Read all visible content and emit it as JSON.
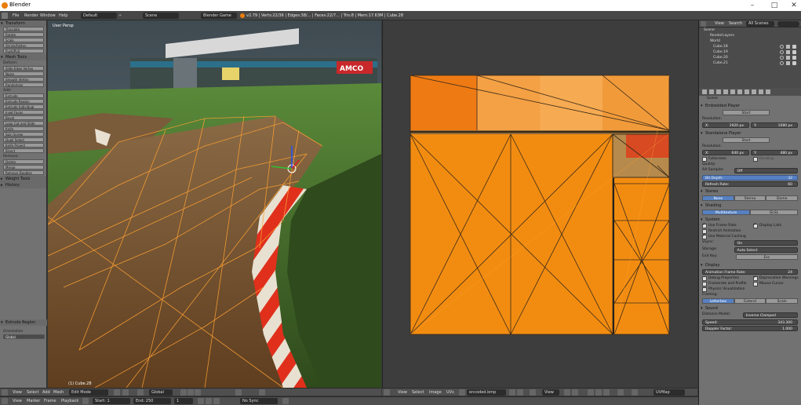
{
  "window": {
    "title": "Blender",
    "minimize": "–",
    "maximize": "□",
    "close": "✕"
  },
  "infobar": {
    "menus": [
      "File",
      "Render",
      "Window",
      "Help"
    ],
    "screen": "Default",
    "scene": "Scene",
    "engine": "Blender Game",
    "stats": "v2.79 | Verts:22/36 | Edges:38/... | Faces:22/7... | Tris:8 | Mem:17.63M | Cube.28"
  },
  "toolshelf": {
    "transform_panel": "Transform",
    "transform_buttons": [
      "Translate",
      "Rotate",
      "Scale",
      "Shrink/Fatten",
      "Push/Pull"
    ],
    "mesh_tools_panel": "Mesh Tools",
    "deform_label": "Deform:",
    "deform_buttons": [
      "Slide Edge  Vertex",
      "Noise",
      "Smooth Vertex",
      "Randomize"
    ],
    "add_label": "Add:",
    "add_buttons": [
      "Extrude",
      "Extrude Region",
      "Extrude Individual",
      "Inset Faces",
      "Bevel",
      "Loop Cut and Slide",
      "Knife",
      "Spin    Screw",
      "Dupli    Select",
      "Knife Project",
      "Bisect"
    ],
    "remove_label": "Remove:",
    "remove_buttons": [
      "Delete",
      "Merge",
      "Remove Doubles"
    ],
    "weight_panel": "Weight Tools",
    "history_panel": "History",
    "operator_panel": "Extrude Region",
    "orientation_label": "Orientation",
    "orientation_value": "Global"
  },
  "viewport": {
    "label": "User Persp",
    "object": "(1) Cube.28",
    "header": [
      "View",
      "Select",
      "Add",
      "Mesh"
    ],
    "mode": "Edit Mode",
    "pivot": "Global"
  },
  "uv_editor": {
    "header": [
      "View",
      "Select",
      "Image",
      "UVs"
    ],
    "image_name": "encoded.bmp",
    "view_label": "View",
    "uvmap": "UVMap"
  },
  "timeline": {
    "menus": [
      "View",
      "Marker",
      "Frame",
      "Playback"
    ],
    "start": "Start: 1",
    "end": "End: 250",
    "frame": "1",
    "sync": "No Sync"
  },
  "outliner": {
    "header": [
      "View",
      "Search",
      "All Scenes"
    ],
    "rows": [
      "Scene",
      "RenderLayers",
      "World",
      "Cube.18",
      "Cube.19",
      "Cube.20",
      "Cube.21"
    ]
  },
  "properties": {
    "scene_label": "Scene",
    "embedded_panel": "Embedded Player",
    "start_btn": "Start",
    "resolution_label": "Resolution:",
    "res_x_label": "X:",
    "res_x": "1920 px",
    "res_y_label": "Y:",
    "res_y": "1080 px",
    "standalone_panel": "Standalone Player",
    "start_btn2": "Start",
    "resolution_label2": "Resolution:",
    "res2_x_label": "X:",
    "res2_x": "640 px",
    "res2_y_label": "Y:",
    "res2_y": "480 px",
    "fullscreen": "Fullscreen",
    "desktop": "Desktop",
    "quality_label": "Quality:",
    "aa_label": "AA Samples",
    "aa_value": "Off",
    "bit_depth_label": "Bit Depth:",
    "bit_depth": "32",
    "refresh_label": "Refresh Rate:",
    "refresh": "60",
    "stereo_panel": "Stereo",
    "stereo_opts": [
      "None",
      "Stereo",
      "Dome"
    ],
    "shading_panel": "Shading",
    "shading_opts": [
      "Multitexture",
      "GLSL"
    ],
    "system_panel": "System",
    "use_frame_rate": "Use Frame Rate",
    "display_lists": "Display Lists",
    "restrict_anim": "Restrict Animation",
    "use_material": "Use Material Caching",
    "vsync_label": "Vsync:",
    "vsync_value": "On",
    "storage_label": "Storage:",
    "storage_value": "Auto Select",
    "exit_key_label": "Exit Key:",
    "exit_key": "Esc",
    "display_panel": "Display",
    "anim_frame_label": "Animation Frame Rate:",
    "anim_frame": "24",
    "debug_props": "Debug Properties",
    "deprecation": "Deprecation Warnings",
    "framerate_profile": "Framerate and Profile",
    "mouse_cursor": "Mouse Cursor",
    "physics_vis": "Physics Visualization",
    "framing_label": "Framing:",
    "framing_opts": [
      "Letterbox",
      "Extend",
      "Scale"
    ],
    "sound_panel": "Sound",
    "dist_model_label": "Distance Model:",
    "dist_model": "Inverse Clamped",
    "speed_label": "Speed:",
    "speed": "343.300",
    "doppler_label": "Doppler Factor:",
    "doppler": "1.000"
  },
  "colors": {
    "uv_orange": "#f28c11",
    "accent": "#5680c2",
    "selection": "#ffa033"
  }
}
